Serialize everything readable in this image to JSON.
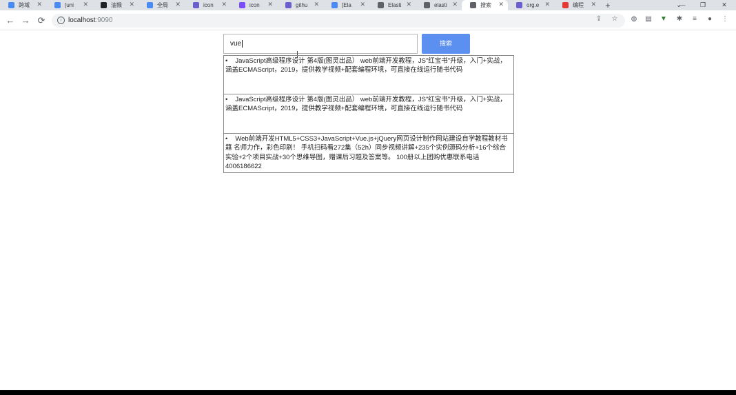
{
  "browser": {
    "tabs": [
      {
        "title": "跨域",
        "color": "#4a8af4",
        "active": false
      },
      {
        "title": "[uni",
        "color": "#4a8af4",
        "active": false
      },
      {
        "title": "油猴",
        "color": "#202124",
        "active": false
      },
      {
        "title": "全局",
        "color": "#4a8af4",
        "active": false
      },
      {
        "title": "icon",
        "color": "#6b5fcf",
        "active": false
      },
      {
        "title": "icon",
        "color": "#7c4dff",
        "active": false
      },
      {
        "title": "githu",
        "color": "#6b5fcf",
        "active": false
      },
      {
        "title": "[Ela",
        "color": "#4a8af4",
        "active": false
      },
      {
        "title": "Elasti",
        "color": "#5f6368",
        "active": false
      },
      {
        "title": "elasti",
        "color": "#5f6368",
        "active": false
      },
      {
        "title": "搜索",
        "color": "#5f6368",
        "active": true
      },
      {
        "title": "org.e",
        "color": "#6b5fcf",
        "active": false
      },
      {
        "title": "编程",
        "color": "#e53935",
        "active": false
      }
    ],
    "new_tab_symbol": "+",
    "url_host": "localhost",
    "url_port": ":9090",
    "icons": {
      "back": "←",
      "forward": "→",
      "reload": "⟳",
      "share": "⇪",
      "star": "☆",
      "ext1": "◍",
      "ext2": "▤",
      "ext3": "▼",
      "puzzle": "✱",
      "reading": "≡",
      "profile": "●",
      "menu": "⋮",
      "minimize": "—",
      "restore": "❐",
      "close": "✕",
      "info": "i"
    }
  },
  "search": {
    "value": "vue",
    "button_label": "搜索"
  },
  "results": [
    {
      "text": "JavaScript高级程序设计 第4版(图灵出品） web前端开发教程，JS\"红宝书\"升级，入门+实战，涵盖ECMAScript，2019，提供教学视频+配套编程环境，可直接在线运行随书代码"
    },
    {
      "text": "JavaScript高级程序设计 第4版(图灵出品） web前端开发教程，JS\"红宝书\"升级，入门+实战，涵盖ECMAScript，2019，提供教学视频+配套编程环境，可直接在线运行随书代码"
    },
    {
      "text": "Web前端开发HTML5+CSS3+JavaScript+Vue.js+jQuery网页设计制作网站建设自学教程教材书籍 名师力作，彩色印刷！ 手机扫码看272集（52h）同步视频讲解+235个实例源码分析+16个综合实验+2个项目实战+30个思维导图，赠课后习题及答案等。 100册以上团购优惠联系电话4006186622"
    }
  ]
}
